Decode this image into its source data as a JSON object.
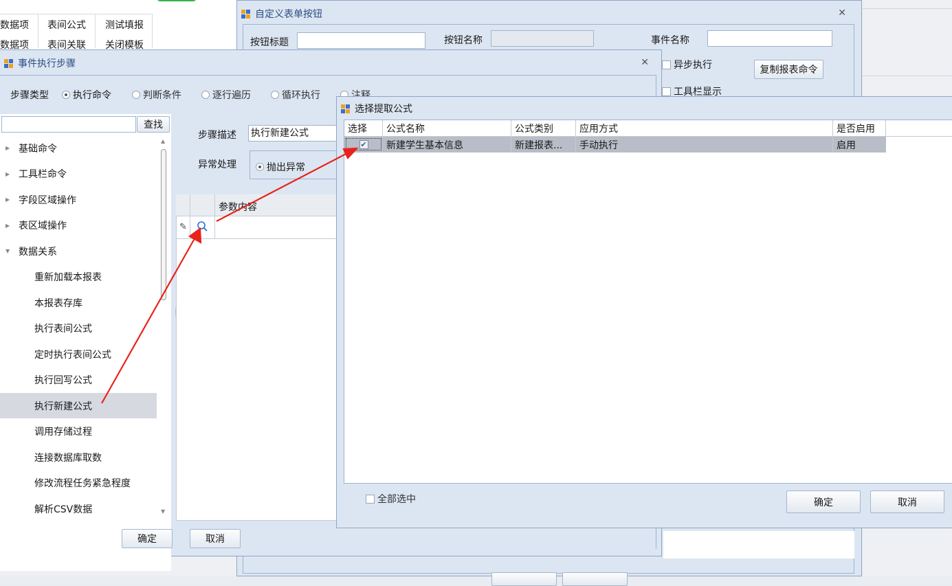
{
  "bg_window": {
    "menu": [
      {
        "label": "数据项"
      },
      {
        "label": "表间公式"
      },
      {
        "label": "测试填报"
      },
      {
        "label": "数据项"
      },
      {
        "label": "表间关联"
      },
      {
        "label": "关闭模板"
      }
    ]
  },
  "custom_button_window": {
    "title": "自定义表单按钮",
    "button_title_label": "按钮标题",
    "button_name_label": "按钮名称",
    "event_name_label": "事件名称",
    "async_label": "异步执行",
    "copy_command_label": "复制报表命令",
    "toolbar_show_label": "工具栏显示"
  },
  "event_steps_window": {
    "title": "事件执行步骤",
    "step_type_label": "步骤类型",
    "step_types": [
      {
        "label": "执行命令",
        "checked": true
      },
      {
        "label": "判断条件",
        "checked": false
      },
      {
        "label": "逐行遍历",
        "checked": false
      },
      {
        "label": "循环执行",
        "checked": false
      },
      {
        "label": "注释",
        "checked": false
      }
    ],
    "search_button": "查找",
    "search_value": "",
    "tree": [
      {
        "label": "基础命令",
        "level": 0,
        "expanded": false
      },
      {
        "label": "工具栏命令",
        "level": 0,
        "expanded": false
      },
      {
        "label": "字段区域操作",
        "level": 0,
        "expanded": false
      },
      {
        "label": "表区域操作",
        "level": 0,
        "expanded": false
      },
      {
        "label": "数据关系",
        "level": 0,
        "expanded": true
      },
      {
        "label": "重新加载本报表",
        "level": 1
      },
      {
        "label": "本报表存库",
        "level": 1
      },
      {
        "label": "执行表间公式",
        "level": 1
      },
      {
        "label": "定时执行表间公式",
        "level": 1
      },
      {
        "label": "执行回写公式",
        "level": 1
      },
      {
        "label": "执行新建公式",
        "level": 1,
        "selected": true
      },
      {
        "label": "调用存储过程",
        "level": 1
      },
      {
        "label": "连接数据库取数",
        "level": 1
      },
      {
        "label": "修改流程任务紧急程度",
        "level": 1
      },
      {
        "label": "解析CSV数据",
        "level": 1
      }
    ],
    "step_desc_label": "步骤描述",
    "step_desc_value": "执行新建公式",
    "exception_label": "异常处理",
    "exception_option": "抛出异常",
    "param_header": "参数内容",
    "ok": "确定",
    "cancel": "取消"
  },
  "select_formula_window": {
    "title": "选择提取公式",
    "columns": [
      "选择",
      "公式名称",
      "公式类别",
      "应用方式",
      "是否启用"
    ],
    "rows": [
      {
        "selected": true,
        "name": "新建学生基本信息",
        "category": "新建报表...",
        "mode": "手动执行",
        "enabled": "启用"
      }
    ],
    "select_all_label": "全部选中",
    "ok": "确定",
    "cancel": "取消"
  },
  "colors": {
    "window_bg": "#dce6f2",
    "border": "#8ea6c7",
    "annotation_arrow": "#e8231b",
    "selected_row": "#b8bdc8"
  }
}
